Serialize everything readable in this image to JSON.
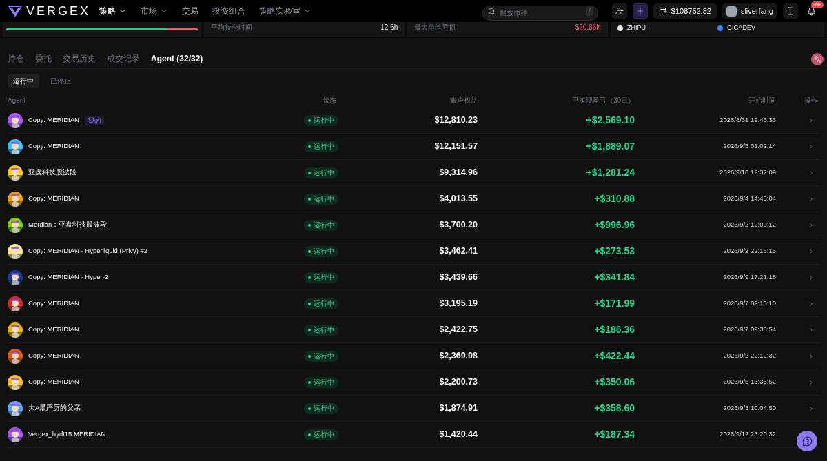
{
  "header": {
    "logo": "VERGEX",
    "nav": [
      {
        "label": "策略",
        "selected": true,
        "has_menu": true
      },
      {
        "label": "市场",
        "selected": false,
        "has_menu": true
      },
      {
        "label": "交易",
        "selected": false,
        "has_menu": false
      },
      {
        "label": "投资组合",
        "selected": false,
        "has_menu": false
      },
      {
        "label": "策略实验室",
        "selected": false,
        "has_menu": true
      }
    ],
    "search": {
      "placeholder": "搜索币种",
      "shortcut": "/"
    },
    "balance": "$108752.82",
    "user": "sliverfang",
    "notifications": "99+"
  },
  "stats": {
    "bar": {
      "level": 0.84
    },
    "avg_hold": {
      "label": "平均持仓时间",
      "value": "12.6h"
    },
    "max_loss": {
      "label": "最大单笔亏损",
      "value": "-$20.86K"
    },
    "models": [
      {
        "name": "ZHIPU",
        "color": "#e5e7eb"
      },
      {
        "name": "GIGADEV",
        "color": "#3b82f6"
      }
    ]
  },
  "tabs": [
    {
      "label": "持仓",
      "selected": false
    },
    {
      "label": "委托",
      "selected": false
    },
    {
      "label": "交易历史",
      "selected": false
    },
    {
      "label": "成交记录",
      "selected": false
    },
    {
      "label": "Agent (32/32)",
      "selected": true
    }
  ],
  "subtabs": [
    {
      "label": "运行中",
      "selected": true
    },
    {
      "label": "已停止",
      "selected": false
    }
  ],
  "table": {
    "columns": [
      "Agent",
      "状态",
      "账户权益",
      "已实现盈亏（30日）",
      "开始时间",
      "操作"
    ],
    "rows": [
      {
        "name": "Copy: MERIDIAN",
        "tag": "我的",
        "status": "运行中",
        "equity": "$12,810.23",
        "pnl": "+$2,569.10",
        "start": "2026/8/31 19:46:33"
      },
      {
        "name": "Copy: MERIDIAN",
        "status": "运行中",
        "equity": "$12,151.57",
        "pnl": "+$1,889.07",
        "start": "2026/9/5 01:02:14"
      },
      {
        "name": "亚盘科技股波段",
        "status": "运行中",
        "equity": "$9,314.96",
        "pnl": "+$1,281.24",
        "start": "2026/9/10 12:32:09"
      },
      {
        "name": "Copy: MERIDIAN",
        "status": "运行中",
        "equity": "$4,013.55",
        "pnl": "+$310.88",
        "start": "2026/9/4 14:43:04"
      },
      {
        "name": "Merdian：亚盘科技股波段",
        "status": "运行中",
        "equity": "$3,700.20",
        "pnl": "+$996.96",
        "start": "2026/9/2 12:00:12"
      },
      {
        "name": "Copy: MERIDIAN · Hyperliquid (Privy) #2",
        "status": "运行中",
        "equity": "$3,462.41",
        "pnl": "+$273.53",
        "start": "2026/9/2 22:16:16"
      },
      {
        "name": "Copy: MERIDIAN · Hyper-2",
        "status": "运行中",
        "equity": "$3,439.66",
        "pnl": "+$341.84",
        "start": "2026/9/9 17:21:18"
      },
      {
        "name": "Copy: MERIDIAN",
        "status": "运行中",
        "equity": "$3,195.19",
        "pnl": "+$171.99",
        "start": "2026/9/7 02:16:10"
      },
      {
        "name": "Copy: MERIDIAN",
        "status": "运行中",
        "equity": "$2,422.75",
        "pnl": "+$186.36",
        "start": "2026/9/7 09:33:54"
      },
      {
        "name": "Copy: MERIDIAN",
        "status": "运行中",
        "equity": "$2,369.98",
        "pnl": "+$422.44",
        "start": "2026/9/2 22:12:32"
      },
      {
        "name": "Copy: MERIDIAN",
        "status": "运行中",
        "equity": "$2,200.73",
        "pnl": "+$350.06",
        "start": "2026/9/5 13:35:52"
      },
      {
        "name": "大A最严厉的父亲",
        "status": "运行中",
        "equity": "$1,874.91",
        "pnl": "+$358.60",
        "start": "2026/9/3 10:04:50"
      },
      {
        "name": "Vergex_hydt15:MERIDIAN",
        "status": "运行中",
        "equity": "$1,420.44",
        "pnl": "+$187.34",
        "start": "2026/9/12 23:20:32"
      }
    ]
  }
}
